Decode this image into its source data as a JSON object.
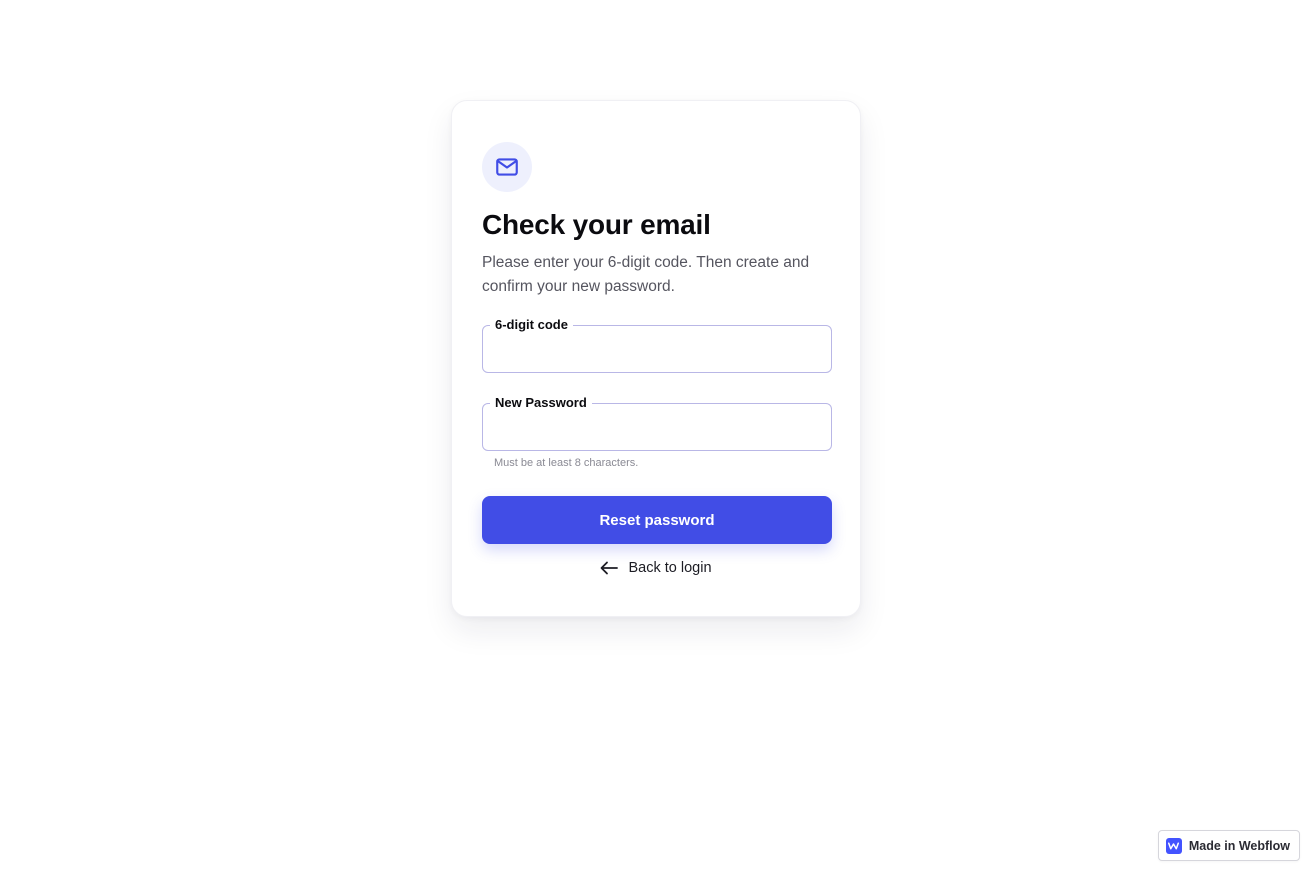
{
  "card": {
    "title": "Check your email",
    "subtitle": "Please enter your 6-digit code. Then create and confirm your new password.",
    "icon": "mail-icon"
  },
  "form": {
    "code_label": "6-digit code",
    "code_value": "",
    "password_label": "New Password",
    "password_value": "",
    "password_hint": "Must be at least 8 characters.",
    "submit_label": "Reset password",
    "back_label": "Back to login",
    "back_icon": "arrow-left-icon"
  },
  "badge": {
    "label": "Made in Webflow",
    "icon": "webflow-logo-icon"
  },
  "colors": {
    "accent": "#414de6",
    "icon_bg": "#eef0fd",
    "field_border": "#b9b7e6",
    "text_primary": "#0b0b0f",
    "text_secondary": "#55555f",
    "hint": "#8a8a94"
  }
}
